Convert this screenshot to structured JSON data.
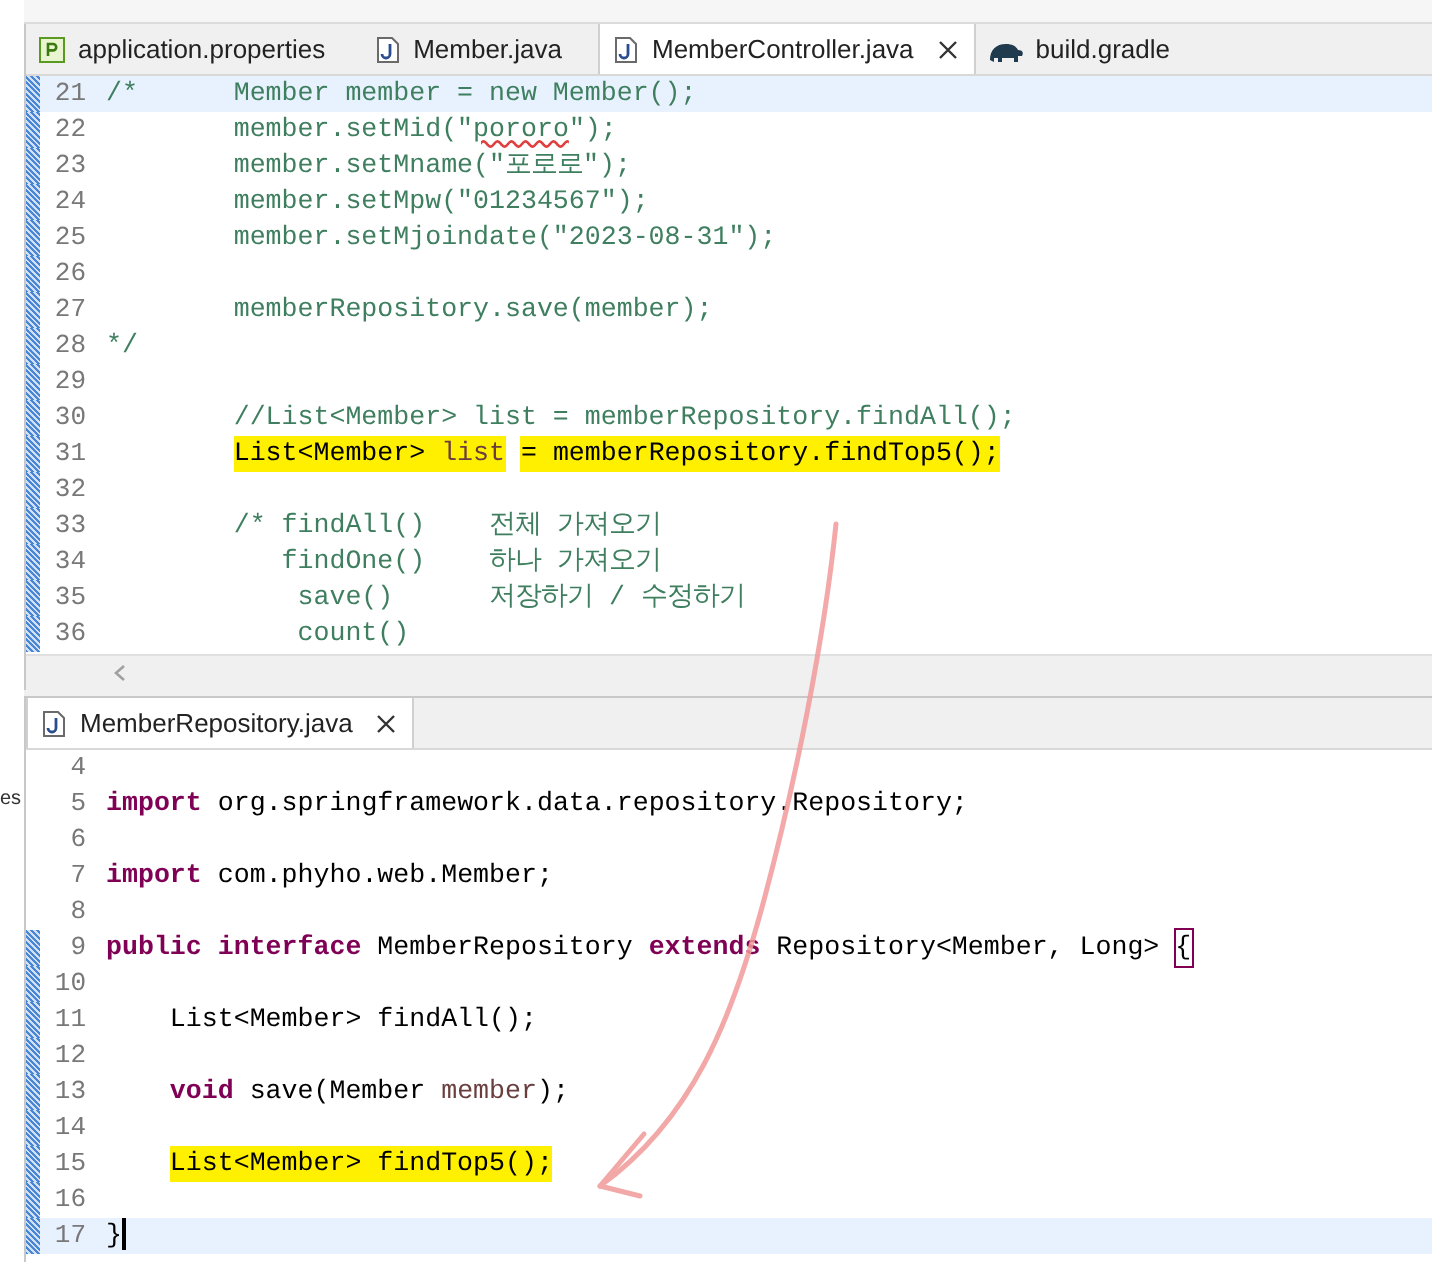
{
  "side_view_text": "es",
  "top_editor": {
    "tabs": [
      {
        "label": "application.properties",
        "kind": "properties",
        "selected": false,
        "closable": false
      },
      {
        "label": "Member.java",
        "kind": "java",
        "selected": false,
        "closable": false
      },
      {
        "label": "MemberController.java",
        "kind": "java",
        "selected": true,
        "closable": true
      },
      {
        "label": "build.gradle",
        "kind": "gradle",
        "selected": false,
        "closable": false
      }
    ],
    "lines": [
      {
        "number": "21",
        "current": true,
        "marked": true,
        "tokens": [
          {
            "text": "/*      Member member = new Member();",
            "kind": "comment"
          }
        ]
      },
      {
        "number": "22",
        "current": false,
        "marked": true,
        "tokens": [
          {
            "text": "        member.setMid(\"",
            "kind": "comment"
          },
          {
            "text": "pororo",
            "kind": "comment",
            "spelling_error": true
          },
          {
            "text": "\");",
            "kind": "comment"
          }
        ]
      },
      {
        "number": "23",
        "current": false,
        "marked": true,
        "tokens": [
          {
            "text": "        member.setMname(\"포로로\");",
            "kind": "comment"
          }
        ]
      },
      {
        "number": "24",
        "current": false,
        "marked": true,
        "tokens": [
          {
            "text": "        member.setMpw(\"01234567\");",
            "kind": "comment"
          }
        ]
      },
      {
        "number": "25",
        "current": false,
        "marked": true,
        "tokens": [
          {
            "text": "        member.setMjoindate(\"2023-08-31\");",
            "kind": "comment"
          }
        ]
      },
      {
        "number": "26",
        "current": false,
        "marked": true
      },
      {
        "number": "27",
        "current": false,
        "marked": true,
        "tokens": [
          {
            "text": "        memberRepository.save(member);",
            "kind": "comment"
          }
        ]
      },
      {
        "number": "28",
        "current": false,
        "marked": true,
        "tokens": [
          {
            "text": "*/",
            "kind": "comment"
          }
        ]
      },
      {
        "number": "29",
        "current": false,
        "marked": true
      },
      {
        "number": "30",
        "current": false,
        "marked": true,
        "tokens": [
          {
            "text": "        //List<Member> list = memberRepository.findAll();",
            "kind": "comment"
          }
        ]
      },
      {
        "number": "31",
        "current": false,
        "marked": true,
        "tokens": [
          {
            "text": "        List<Member> ",
            "kind": "plain",
            "highlighted": true
          },
          {
            "text": "list",
            "kind": "variable",
            "highlighted": true
          },
          {
            "text": " = memberRepository.findTop5();",
            "kind": "plain",
            "highlighted": true
          }
        ]
      },
      {
        "number": "32",
        "current": false,
        "marked": true
      },
      {
        "number": "33",
        "current": false,
        "marked": true,
        "tokens": [
          {
            "text": "        /* findAll()    전체 가져오기",
            "kind": "comment"
          }
        ]
      },
      {
        "number": "34",
        "current": false,
        "marked": true,
        "tokens": [
          {
            "text": "           findOne()    하나 가져오기",
            "kind": "comment"
          }
        ]
      },
      {
        "number": "35",
        "current": false,
        "marked": true,
        "tokens": [
          {
            "text": "            save()      저장하기 / 수정하기",
            "kind": "comment"
          }
        ]
      },
      {
        "number": "36",
        "current": false,
        "marked": true,
        "tokens": [
          {
            "text": "            count()",
            "kind": "comment"
          }
        ]
      }
    ]
  },
  "bottom_editor": {
    "tabs": [
      {
        "label": "MemberRepository.java",
        "kind": "java",
        "selected": true,
        "closable": true
      }
    ],
    "lines": [
      {
        "number": "4",
        "current": false,
        "marked": false
      },
      {
        "number": "5",
        "current": false,
        "marked": false,
        "tokens": [
          {
            "text": "import",
            "kind": "keyword"
          },
          {
            "text": " org.springframework.data.repository.Repository;",
            "kind": "plain"
          }
        ]
      },
      {
        "number": "6",
        "current": false,
        "marked": false
      },
      {
        "number": "7",
        "current": false,
        "marked": false,
        "tokens": [
          {
            "text": "import",
            "kind": "keyword"
          },
          {
            "text": " com.phyho.web.Member;",
            "kind": "plain"
          }
        ]
      },
      {
        "number": "8",
        "current": false,
        "marked": false
      },
      {
        "number": "9",
        "current": false,
        "marked": true,
        "tokens": [
          {
            "text": "public interface",
            "kind": "keyword"
          },
          {
            "text": " MemberRepository ",
            "kind": "plain"
          },
          {
            "text": "extends",
            "kind": "keyword"
          },
          {
            "text": " Repository<Member, Long> ",
            "kind": "plain"
          },
          {
            "text": "{",
            "kind": "bracket_match"
          }
        ]
      },
      {
        "number": "10",
        "current": false,
        "marked": true
      },
      {
        "number": "11",
        "current": false,
        "marked": true,
        "tokens": [
          {
            "text": "    List<Member> findAll();",
            "kind": "plain"
          }
        ]
      },
      {
        "number": "12",
        "current": false,
        "marked": true
      },
      {
        "number": "13",
        "current": false,
        "marked": true,
        "tokens": [
          {
            "text": "    void",
            "kind": "keyword"
          },
          {
            "text": " save(Member ",
            "kind": "plain"
          },
          {
            "text": "member",
            "kind": "variable"
          },
          {
            "text": ");",
            "kind": "plain"
          }
        ]
      },
      {
        "number": "14",
        "current": false,
        "marked": true
      },
      {
        "number": "15",
        "current": false,
        "marked": true,
        "tokens": [
          {
            "text": "    List<Member> findTop5();",
            "kind": "plain",
            "highlighted": true
          }
        ]
      },
      {
        "number": "16",
        "current": false,
        "marked": true
      },
      {
        "number": "17",
        "current": true,
        "marked": true,
        "cursor": true,
        "tokens": [
          {
            "text": "}",
            "kind": "plain"
          }
        ]
      }
    ]
  }
}
